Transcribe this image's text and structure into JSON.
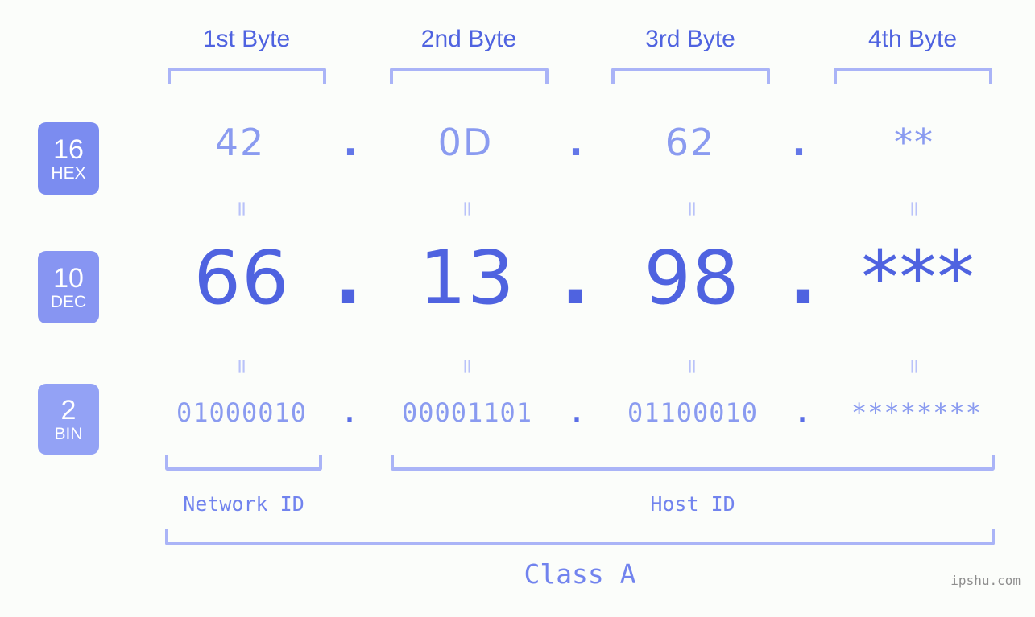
{
  "meta": {
    "background_color": "#fbfdfa",
    "accent_dark": "#4f63e0",
    "accent_mid": "#7b8cf0",
    "accent_light": "#8a9bf0",
    "bracket_color": "#aab4f7",
    "watermark": "ipshu.com"
  },
  "byte_headers": [
    {
      "label": "1st Byte"
    },
    {
      "label": "2nd Byte"
    },
    {
      "label": "3rd Byte"
    },
    {
      "label": "4th Byte"
    }
  ],
  "separators": {
    "dot": "."
  },
  "equals_mark": "=",
  "rows": [
    {
      "id": "hex",
      "radix": "16",
      "name": "HEX",
      "values": [
        "42",
        "0D",
        "62",
        "**"
      ]
    },
    {
      "id": "dec",
      "radix": "10",
      "name": "DEC",
      "values": [
        "66",
        "13",
        "98",
        "***"
      ]
    },
    {
      "id": "bin",
      "radix": "2",
      "name": "BIN",
      "values": [
        "01000010",
        "00001101",
        "01100010",
        "********"
      ]
    }
  ],
  "segments": {
    "network_id": "Network ID",
    "host_id": "Host ID",
    "class": "Class A"
  },
  "chart_data": {
    "type": "table",
    "title": "IP address byte breakdown by radix",
    "categories": [
      "1st Byte",
      "2nd Byte",
      "3rd Byte",
      "4th Byte"
    ],
    "series": [
      {
        "name": "HEX",
        "values": [
          "42",
          "0D",
          "62",
          "**"
        ]
      },
      {
        "name": "DEC",
        "values": [
          "66",
          "13",
          "98",
          "***"
        ]
      },
      {
        "name": "BIN",
        "values": [
          "01000010",
          "00001101",
          "01100010",
          "********"
        ]
      }
    ],
    "annotations": {
      "network_id_bytes": [
        "1st Byte"
      ],
      "host_id_bytes": [
        "2nd Byte",
        "3rd Byte",
        "4th Byte"
      ],
      "class": "Class A"
    },
    "xlabel": "",
    "ylabel": "",
    "legend": [
      "16 HEX",
      "10 DEC",
      "2 BIN"
    ]
  }
}
